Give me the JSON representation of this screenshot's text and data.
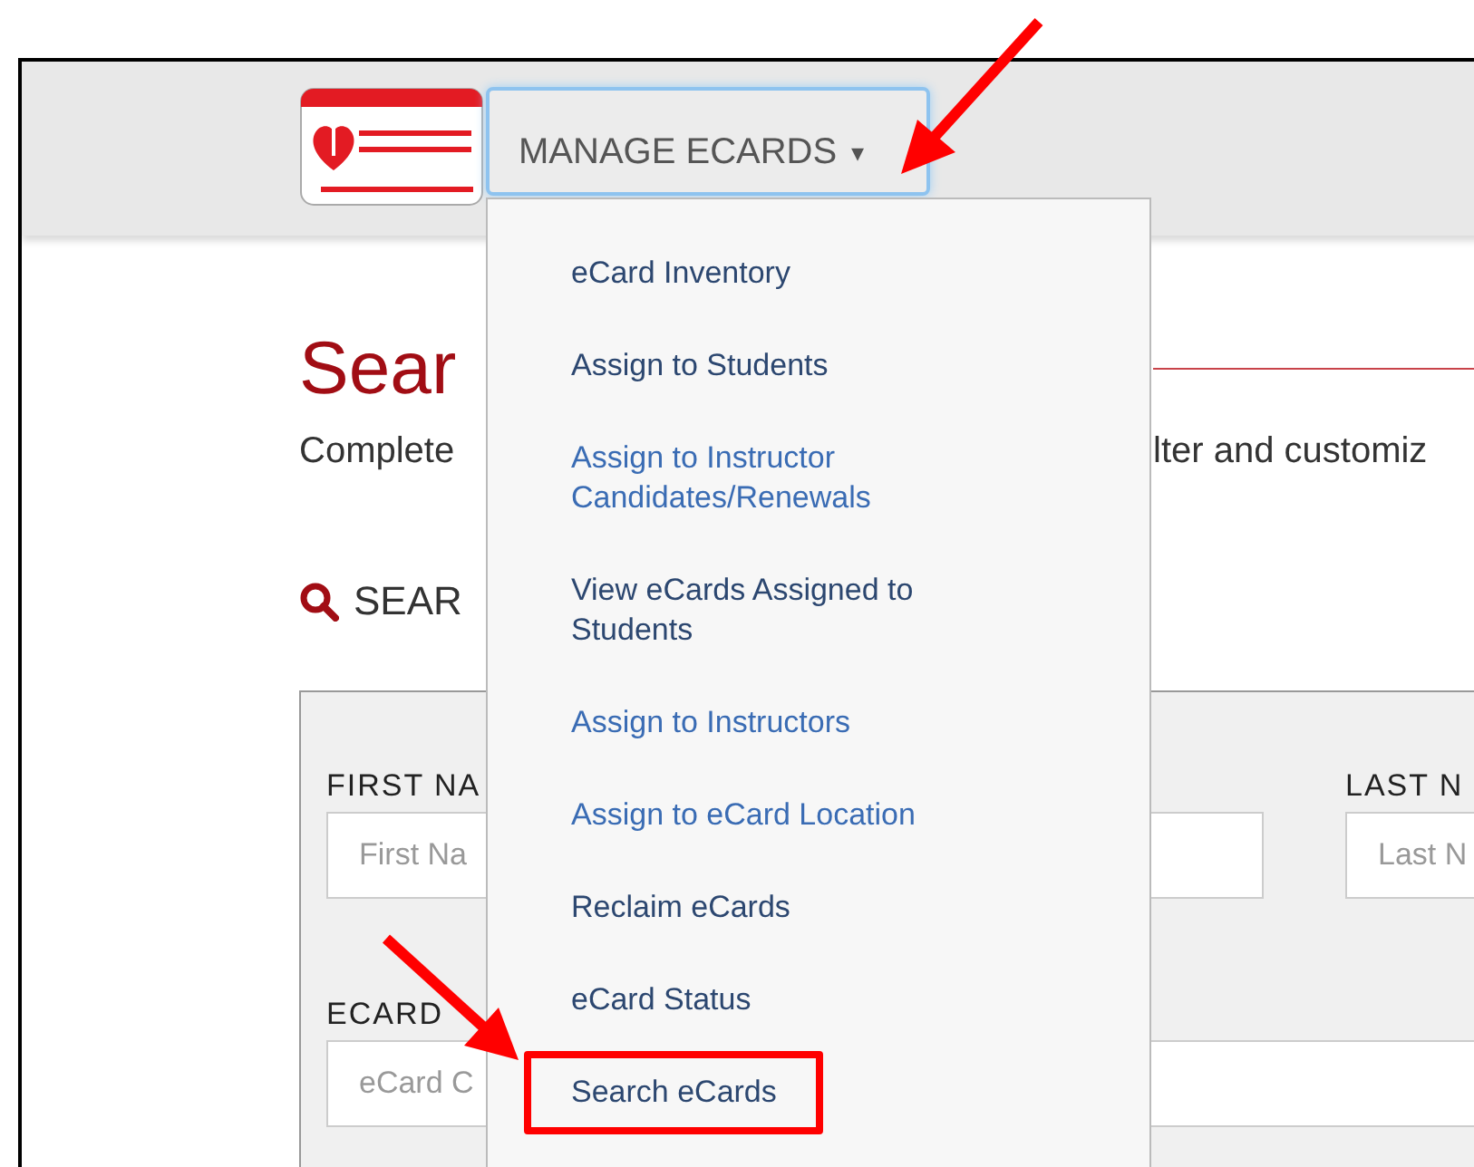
{
  "header": {
    "menu_button": {
      "label": "MANAGE ECARDS",
      "caret": "▾",
      "expanded": true
    }
  },
  "menu": {
    "items": [
      {
        "label": "eCard Inventory",
        "color": "#2c4770",
        "highlighted": false
      },
      {
        "label": "Assign to Students",
        "color": "#2c4770",
        "highlighted": false
      },
      {
        "label": "Assign to Instructor Candidates/Renewals",
        "color": "#3a6cb4",
        "highlighted": false
      },
      {
        "label": "View eCards Assigned to Students",
        "color": "#2c4770",
        "highlighted": false
      },
      {
        "label": "Assign to Instructors",
        "color": "#3a6cb4",
        "highlighted": false
      },
      {
        "label": "Assign to eCard Location",
        "color": "#3a6cb4",
        "highlighted": false
      },
      {
        "label": "Reclaim eCards",
        "color": "#2c4770",
        "highlighted": false
      },
      {
        "label": "eCard Status",
        "color": "#2c4770",
        "highlighted": false
      },
      {
        "label": "Search eCards",
        "color": "#2c4770",
        "highlighted": true
      }
    ]
  },
  "page": {
    "title": "Sear",
    "intro_left": "Complete",
    "intro_right": "lter and customiz",
    "section_title": "SEAR"
  },
  "form": {
    "fields": [
      {
        "label": "FIRST NA",
        "placeholder": "First Na"
      },
      {
        "label": "LAST N",
        "placeholder": "Last N"
      },
      {
        "label": "ECARD",
        "placeholder": "eCard C"
      }
    ]
  }
}
